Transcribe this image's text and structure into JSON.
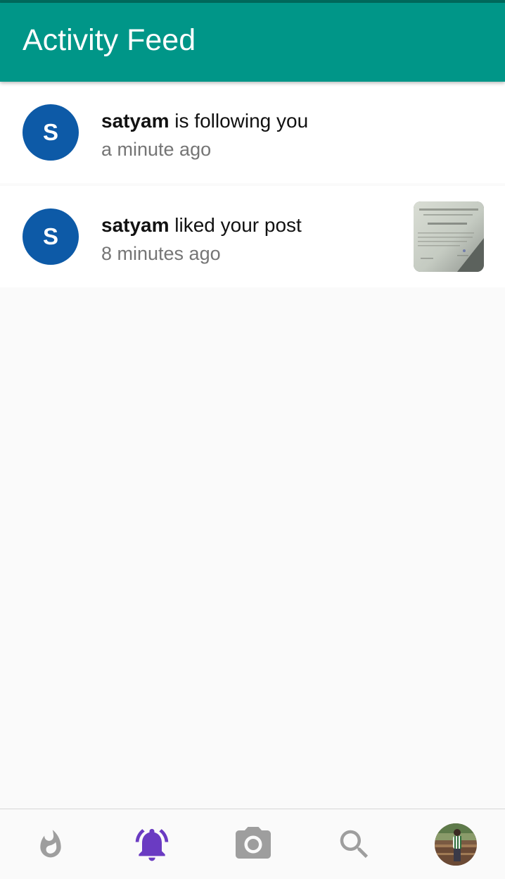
{
  "app_title": "Activity Feed",
  "feed": [
    {
      "avatar_letter": "S",
      "username": "satyam",
      "action": " is following you",
      "time": "a minute ago",
      "avatar_color": "#0d5aa7"
    },
    {
      "avatar_letter": "S",
      "username": "satyam",
      "action": " liked your post",
      "time": "8 minutes ago",
      "avatar_color": "#0d5aa7",
      "thumbnail": "certificate-photo"
    }
  ],
  "bottom_nav": {
    "items": [
      {
        "icon": "whatshot-icon",
        "active": false
      },
      {
        "icon": "notifications-active-icon",
        "active": true
      },
      {
        "icon": "photo-camera-icon",
        "active": false
      },
      {
        "icon": "search-icon",
        "active": false
      },
      {
        "icon": "profile-avatar",
        "active": false
      }
    ]
  },
  "colors": {
    "primary": "#009688",
    "status_bar": "#00695c",
    "active_nav": "#6a3bc2",
    "inactive_nav": "#9e9e9e"
  }
}
